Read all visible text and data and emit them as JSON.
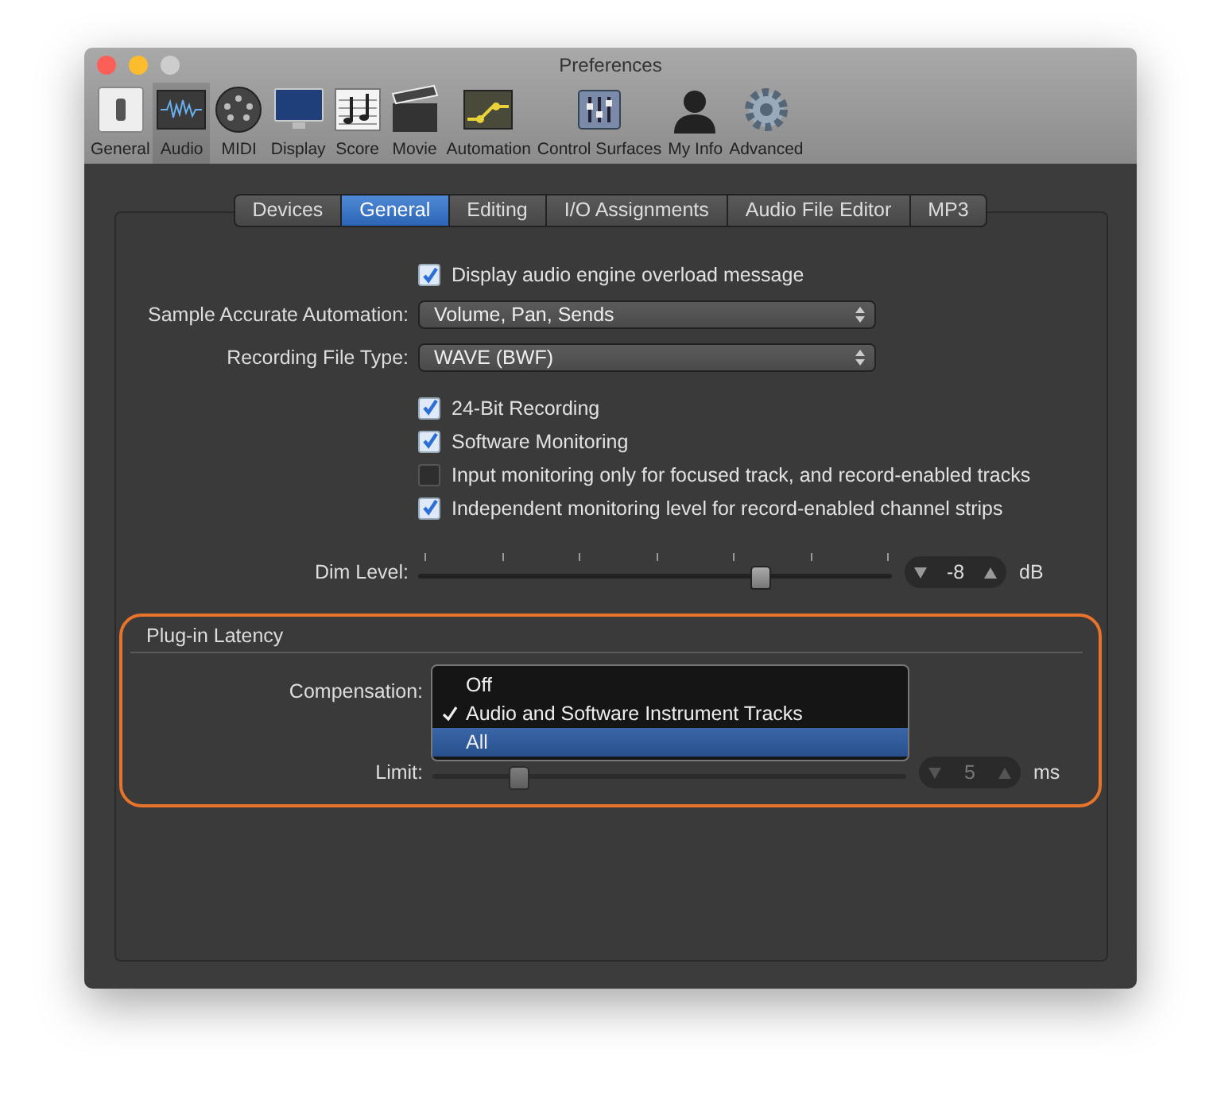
{
  "window": {
    "title": "Preferences"
  },
  "toolbar": [
    {
      "label": "General",
      "selected": false
    },
    {
      "label": "Audio",
      "selected": true
    },
    {
      "label": "MIDI",
      "selected": false
    },
    {
      "label": "Display",
      "selected": false
    },
    {
      "label": "Score",
      "selected": false
    },
    {
      "label": "Movie",
      "selected": false
    },
    {
      "label": "Automation",
      "selected": false
    },
    {
      "label": "Control Surfaces",
      "selected": false
    },
    {
      "label": "My Info",
      "selected": false
    },
    {
      "label": "Advanced",
      "selected": false
    }
  ],
  "tabs": [
    {
      "label": "Devices",
      "selected": false
    },
    {
      "label": "General",
      "selected": true
    },
    {
      "label": "Editing",
      "selected": false
    },
    {
      "label": "I/O Assignments",
      "selected": false
    },
    {
      "label": "Audio File Editor",
      "selected": false
    },
    {
      "label": "MP3",
      "selected": false
    }
  ],
  "overload_message": {
    "label": "Display audio engine overload message",
    "checked": true
  },
  "sample_accurate_automation": {
    "label": "Sample Accurate Automation:",
    "value": "Volume, Pan, Sends"
  },
  "recording_file_type": {
    "label": "Recording File Type:",
    "value": "WAVE (BWF)"
  },
  "options": [
    {
      "label": "24-Bit Recording",
      "checked": true
    },
    {
      "label": "Software Monitoring",
      "checked": true
    },
    {
      "label": "Input monitoring only for focused track, and record-enabled tracks",
      "checked": false
    },
    {
      "label": "Independent monitoring level for record-enabled channel strips",
      "checked": true
    }
  ],
  "dim_level": {
    "label": "Dim Level:",
    "level": 0.72,
    "value": "-8",
    "unit": "dB",
    "disabled": false
  },
  "plugin_latency": {
    "title": "Plug-in Latency",
    "compensation": {
      "label": "Compensation:",
      "menu": [
        {
          "label": "Off",
          "checked": false,
          "selected": false
        },
        {
          "label": "Audio and Software Instrument Tracks",
          "checked": true,
          "selected": false
        },
        {
          "label": "All",
          "checked": false,
          "selected": true
        }
      ]
    },
    "limit": {
      "label": "Limit:",
      "level": 0.18,
      "value": "5",
      "unit": "ms",
      "disabled": true
    }
  }
}
